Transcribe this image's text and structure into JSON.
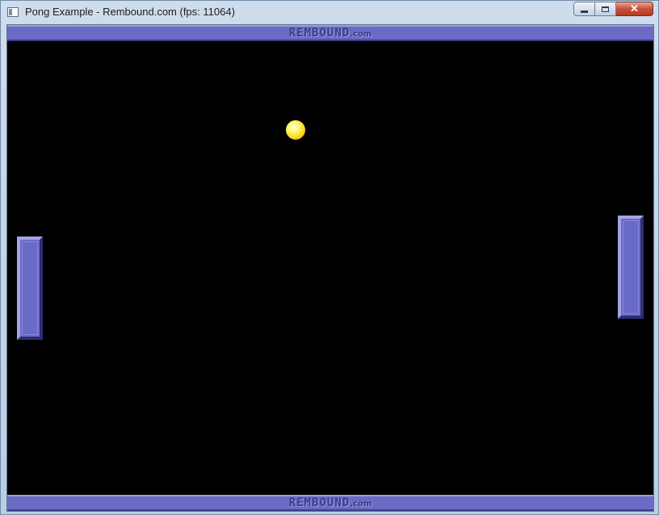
{
  "window": {
    "title": "Pong Example - Rembound.com (fps: 11064)",
    "icon": "app-window-icon",
    "controls": {
      "minimize": "minimize-icon",
      "maximize": "maximize-icon",
      "close_label": "✕"
    }
  },
  "banner": {
    "top": {
      "logo": "REMBOUND",
      "suffix": ".com"
    },
    "bottom": {
      "logo": "REMBOUND",
      "suffix": ".com"
    },
    "color": "#6b6bc6"
  },
  "game": {
    "background": "#000000",
    "paddle_color": "#6a6ac8",
    "ball_color": "#fff86a"
  }
}
